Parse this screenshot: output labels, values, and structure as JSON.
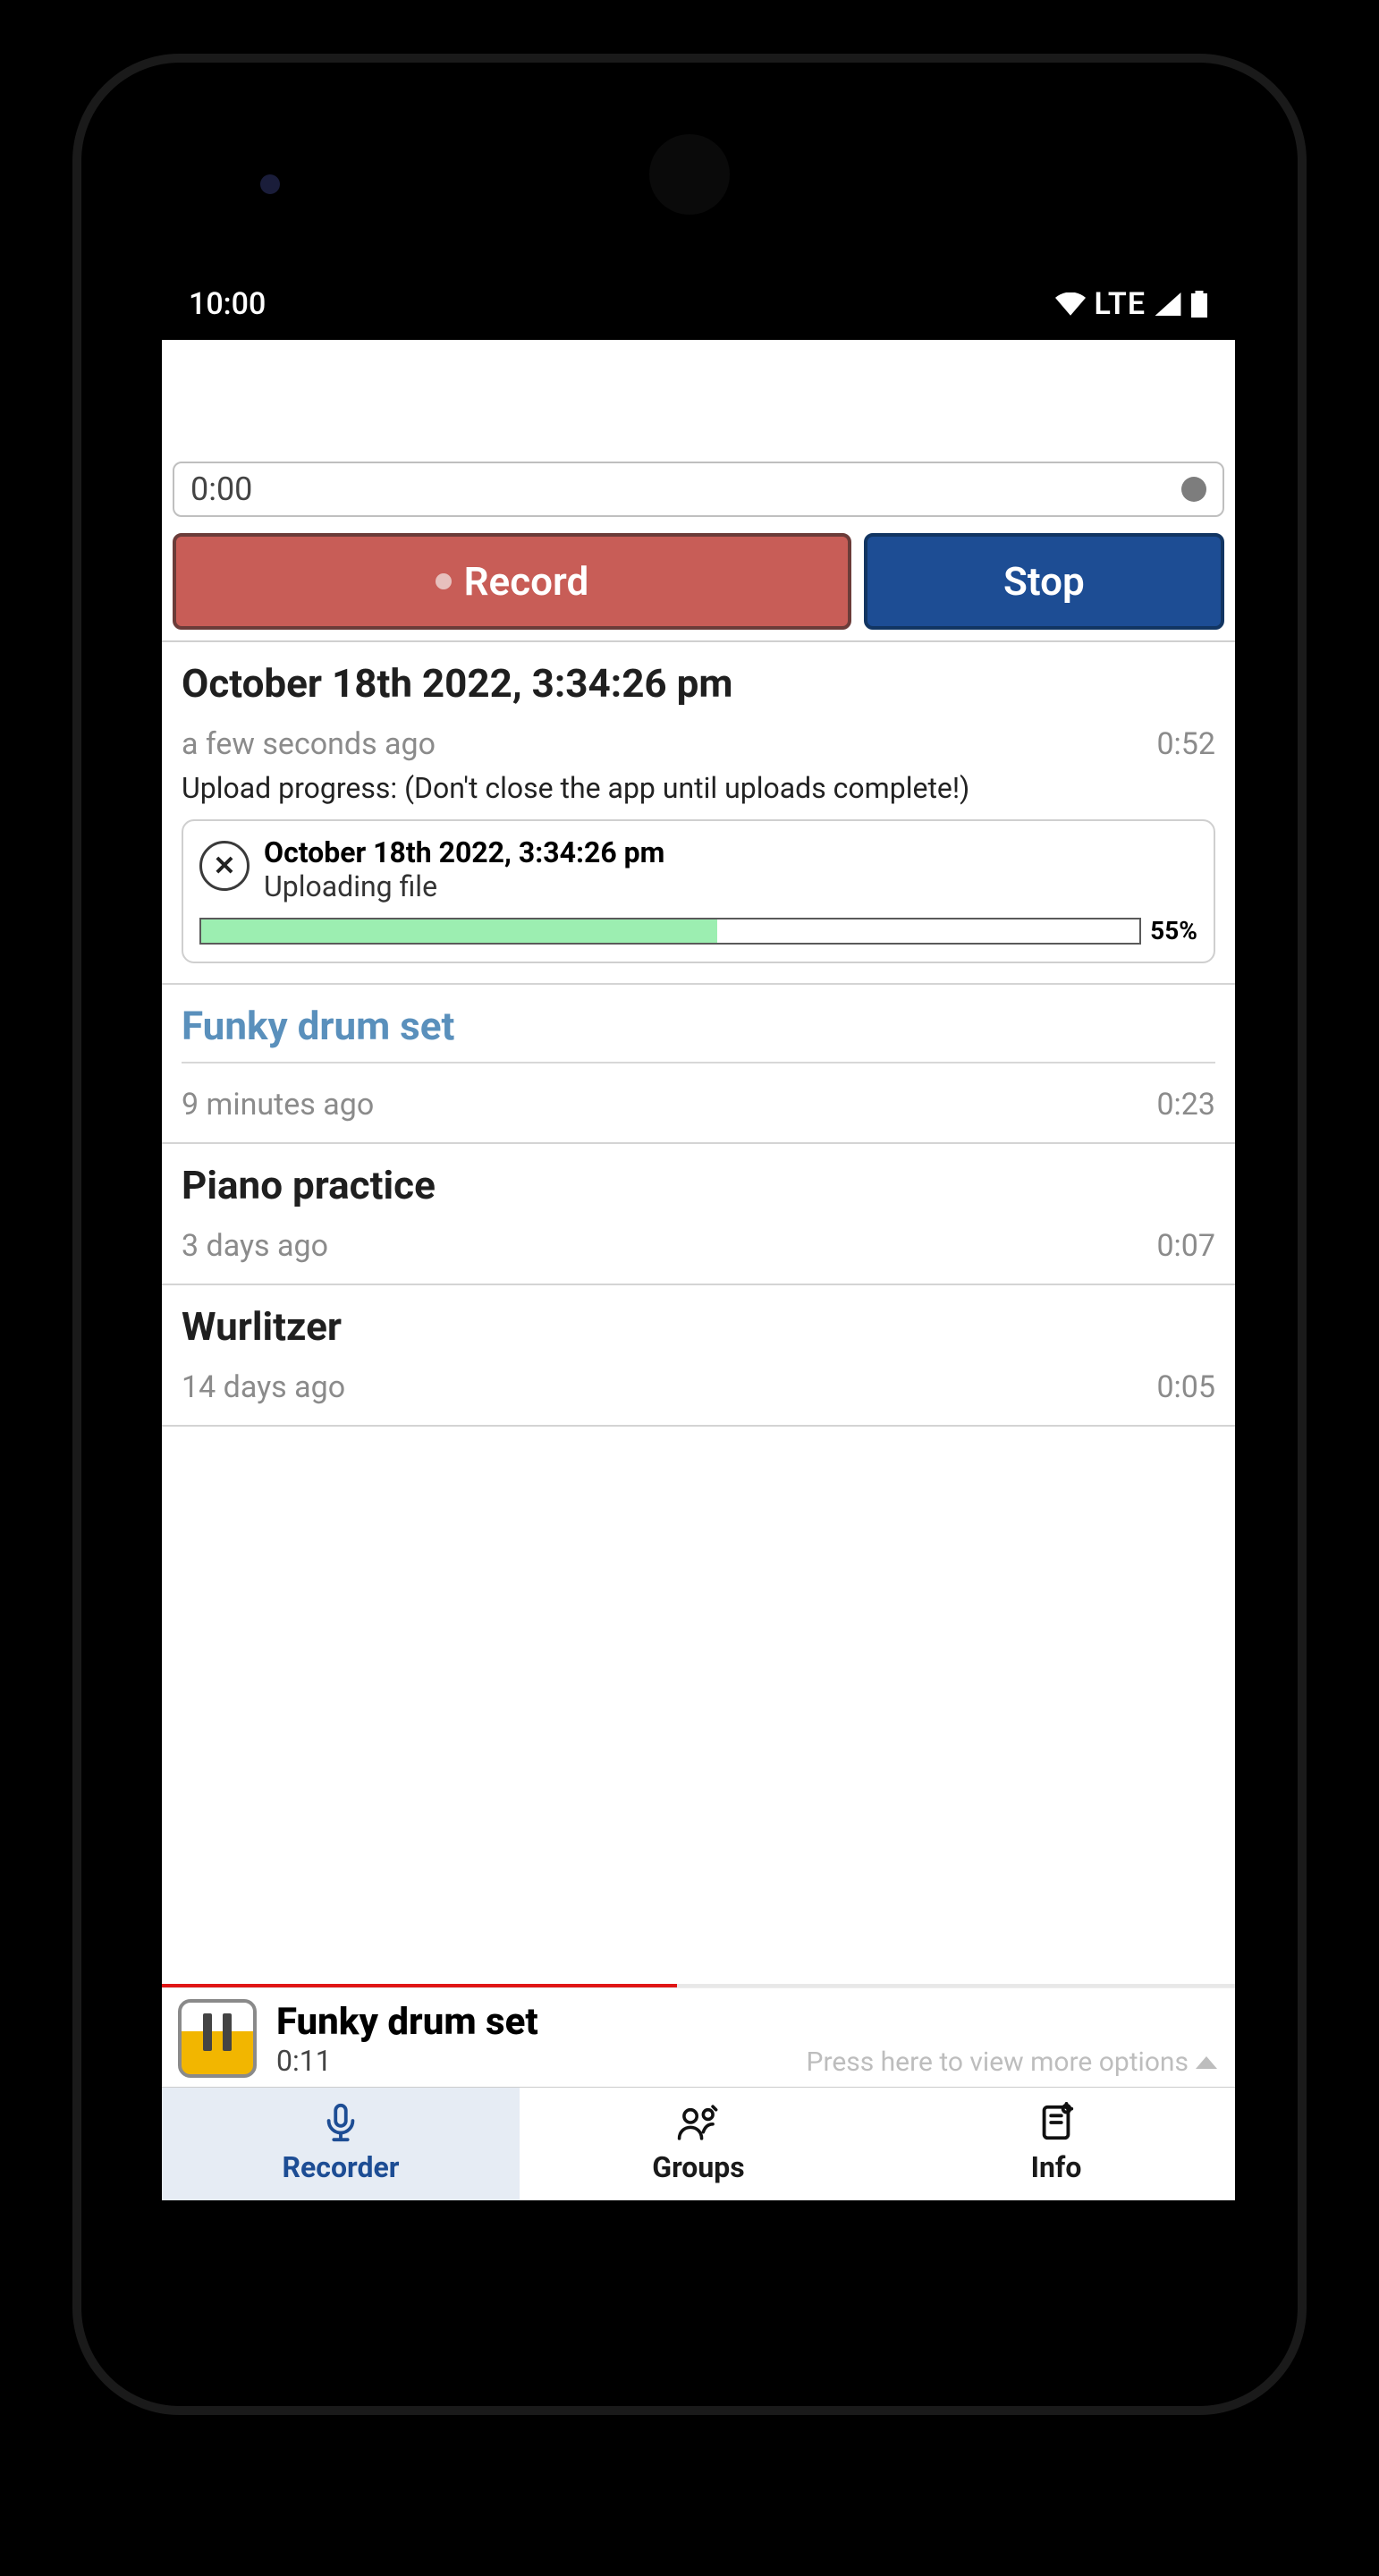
{
  "status": {
    "time": "10:00",
    "network": "LTE"
  },
  "recorder": {
    "timer": "0:00",
    "record_label": "Record",
    "stop_label": "Stop"
  },
  "recordings": [
    {
      "title": "October 18th 2022, 3:34:26 pm",
      "ago": "a few seconds ago",
      "duration": "0:52",
      "upload_note": "Upload progress: (Don't close the app until uploads complete!)",
      "upload": {
        "title": "October 18th 2022, 3:34:26 pm",
        "status": "Uploading file",
        "percent_label": "55%",
        "percent": 55
      }
    },
    {
      "title": "Funky drum set",
      "ago": "9 minutes ago",
      "duration": "0:23",
      "is_link": true
    },
    {
      "title": "Piano practice",
      "ago": "3 days ago",
      "duration": "0:07"
    },
    {
      "title": "Wurlitzer",
      "ago": "14 days ago",
      "duration": "0:05"
    }
  ],
  "nowplaying": {
    "title": "Funky drum set",
    "time": "0:11",
    "hint": "Press here to view more options",
    "progress": 48
  },
  "tabs": {
    "recorder": "Recorder",
    "groups": "Groups",
    "info": "Info"
  }
}
